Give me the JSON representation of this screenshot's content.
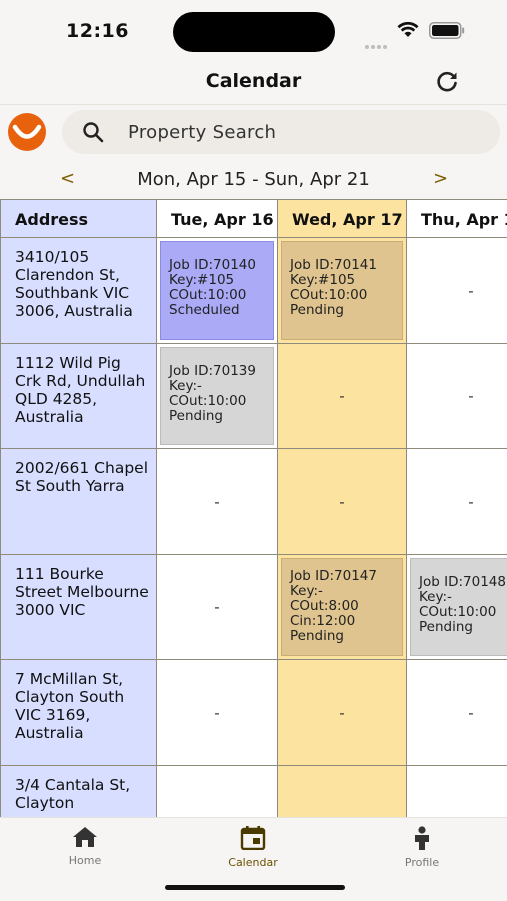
{
  "status": {
    "time": "12:16"
  },
  "header": {
    "title": "Calendar",
    "refresh_icon": "refresh-icon"
  },
  "search": {
    "placeholder": "Property Search"
  },
  "week": {
    "prev": "<",
    "range": "Mon, Apr 15 - Sun, Apr 21",
    "next": ">"
  },
  "table": {
    "columns": [
      "Address",
      "Tue, Apr 16",
      "Wed, Apr 17",
      "Thu, Apr 18"
    ],
    "rows": [
      {
        "address": "3410/105 Clarendon St, Southbank VIC 3006, Australia",
        "cells": [
          {
            "type": "job",
            "color": "blue",
            "lines": [
              "Job ID:70140",
              "Key:#105",
              "COut:10:00",
              "Scheduled"
            ]
          },
          {
            "type": "job",
            "color": "tan",
            "lines": [
              "Job ID:70141",
              "Key:#105",
              "COut:10:00",
              "Pending"
            ]
          },
          {
            "type": "empty",
            "text": "-"
          }
        ]
      },
      {
        "address": "1112 Wild Pig Crk Rd, Undullah QLD 4285, Australia",
        "cells": [
          {
            "type": "job",
            "color": "gray",
            "lines": [
              "Job ID:70139",
              "Key:-",
              "COut:10:00",
              "Pending"
            ]
          },
          {
            "type": "empty",
            "text": "-"
          },
          {
            "type": "empty",
            "text": "-"
          }
        ]
      },
      {
        "address": "2002/661 Chapel St South Yarra",
        "cells": [
          {
            "type": "empty",
            "text": "-"
          },
          {
            "type": "empty",
            "text": "-"
          },
          {
            "type": "empty",
            "text": "-"
          }
        ]
      },
      {
        "address": "111 Bourke Street Melbourne 3000 VIC",
        "cells": [
          {
            "type": "empty",
            "text": "-"
          },
          {
            "type": "job",
            "color": "tan",
            "lines": [
              "Job ID:70147",
              "Key:-",
              "COut:8:00",
              "Cin:12:00",
              "Pending"
            ]
          },
          {
            "type": "job",
            "color": "gray",
            "lines": [
              "Job ID:70148",
              "Key:-",
              "COut:10:00",
              "Pending"
            ]
          }
        ]
      },
      {
        "address": "7 McMillan St, Clayton South VIC 3169, Australia",
        "cells": [
          {
            "type": "empty",
            "text": "-"
          },
          {
            "type": "empty",
            "text": "-"
          },
          {
            "type": "empty",
            "text": "-"
          }
        ]
      },
      {
        "address": "3/4 Cantala St, Clayton",
        "cells": [
          {
            "type": "empty",
            "text": ""
          },
          {
            "type": "empty",
            "text": ""
          },
          {
            "type": "empty",
            "text": ""
          }
        ]
      }
    ]
  },
  "tabs": [
    {
      "label": "Home",
      "icon": "home-icon",
      "active": false
    },
    {
      "label": "Calendar",
      "icon": "calendar-icon",
      "active": true
    },
    {
      "label": "Profile",
      "icon": "person-icon",
      "active": false
    }
  ],
  "colors": {
    "address_col": "#d8deff",
    "wed_col": "#fde3a0",
    "job_blue": "#aaaaf6",
    "job_tan": "#dfc48f",
    "job_gray": "#d6d6d6",
    "accent": "#7a5c00"
  }
}
